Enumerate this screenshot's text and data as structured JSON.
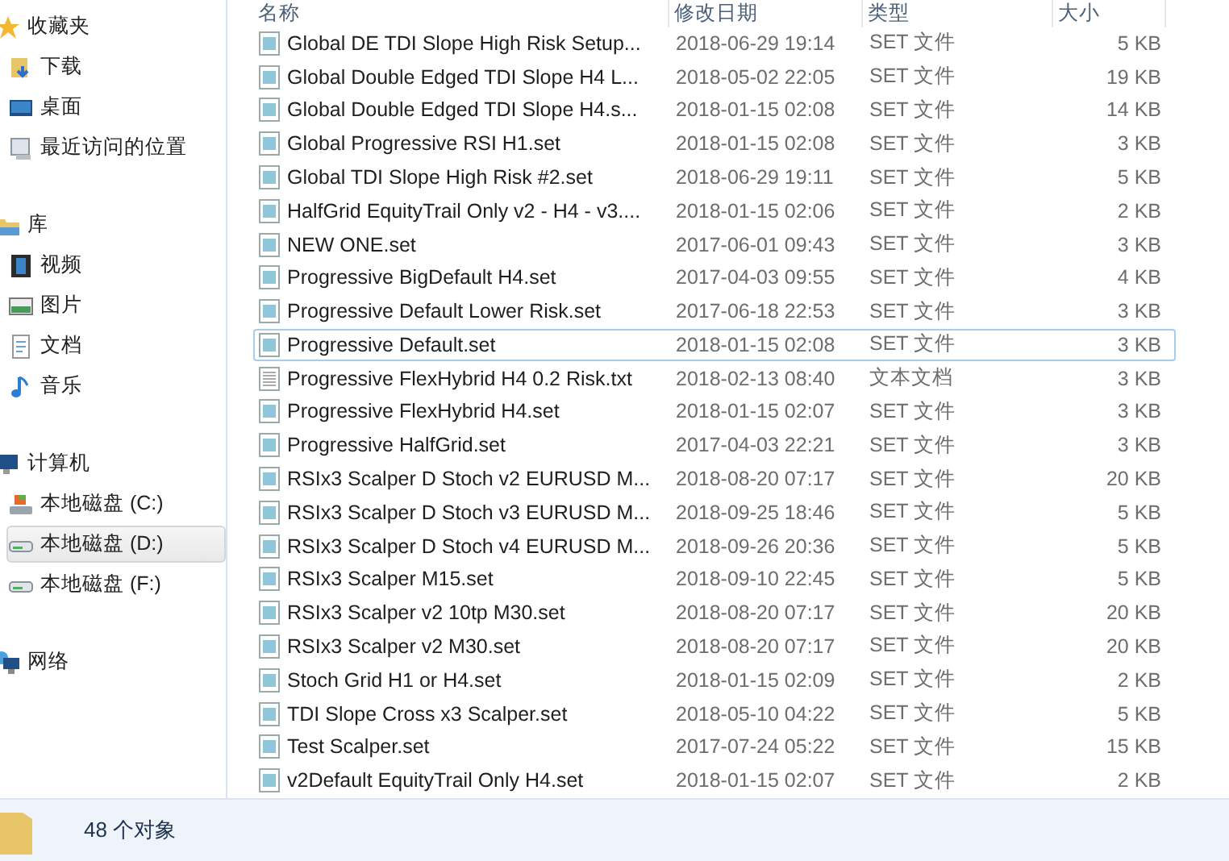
{
  "sidebar": {
    "groups": [
      {
        "label": "收藏夹",
        "kind": "star",
        "children": [
          {
            "label": "下载",
            "kind": "download",
            "selected": false
          },
          {
            "label": "桌面",
            "kind": "desktop",
            "selected": false
          },
          {
            "label": "最近访问的位置",
            "kind": "recent",
            "selected": false
          }
        ]
      },
      {
        "label": "库",
        "kind": "library",
        "children": [
          {
            "label": "视频",
            "kind": "video",
            "selected": false
          },
          {
            "label": "图片",
            "kind": "picture",
            "selected": false
          },
          {
            "label": "文档",
            "kind": "document",
            "selected": false
          },
          {
            "label": "音乐",
            "kind": "music",
            "selected": false
          }
        ]
      },
      {
        "label": "计算机",
        "kind": "computer",
        "children": [
          {
            "label": "本地磁盘 (C:)",
            "kind": "drive-system",
            "selected": false
          },
          {
            "label": "本地磁盘 (D:)",
            "kind": "drive",
            "selected": true
          },
          {
            "label": "本地磁盘 (F:)",
            "kind": "drive",
            "selected": false
          }
        ]
      },
      {
        "label": "网络",
        "kind": "network"
      }
    ]
  },
  "table": {
    "columns": [
      "名称",
      "修改日期",
      "类型",
      "大小"
    ],
    "rows": [
      {
        "name": "Global DE TDI Slope High Risk Setup...",
        "date": "2018-06-29 19:14",
        "type": "SET 文件",
        "size": "5 KB",
        "kind": "set",
        "selected": false
      },
      {
        "name": "Global Double Edged TDI Slope H4 L...",
        "date": "2018-05-02 22:05",
        "type": "SET 文件",
        "size": "19 KB",
        "kind": "set",
        "selected": false
      },
      {
        "name": "Global Double Edged TDI Slope H4.s...",
        "date": "2018-01-15 02:08",
        "type": "SET 文件",
        "size": "14 KB",
        "kind": "set",
        "selected": false
      },
      {
        "name": "Global Progressive RSI H1.set",
        "date": "2018-01-15 02:08",
        "type": "SET 文件",
        "size": "3 KB",
        "kind": "set",
        "selected": false
      },
      {
        "name": "Global TDI Slope High Risk #2.set",
        "date": "2018-06-29 19:11",
        "type": "SET 文件",
        "size": "5 KB",
        "kind": "set",
        "selected": false
      },
      {
        "name": "HalfGrid EquityTrail Only v2 - H4 - v3....",
        "date": "2018-01-15 02:06",
        "type": "SET 文件",
        "size": "2 KB",
        "kind": "set",
        "selected": false
      },
      {
        "name": "NEW ONE.set",
        "date": "2017-06-01 09:43",
        "type": "SET 文件",
        "size": "3 KB",
        "kind": "set",
        "selected": false
      },
      {
        "name": "Progressive BigDefault H4.set",
        "date": "2017-04-03 09:55",
        "type": "SET 文件",
        "size": "4 KB",
        "kind": "set",
        "selected": false
      },
      {
        "name": "Progressive Default Lower Risk.set",
        "date": "2017-06-18 22:53",
        "type": "SET 文件",
        "size": "3 KB",
        "kind": "set",
        "selected": false
      },
      {
        "name": "Progressive Default.set",
        "date": "2018-01-15 02:08",
        "type": "SET 文件",
        "size": "3 KB",
        "kind": "set",
        "selected": true
      },
      {
        "name": "Progressive FlexHybrid H4 0.2 Risk.txt",
        "date": "2018-02-13 08:40",
        "type": "文本文档",
        "size": "3 KB",
        "kind": "txt",
        "selected": false
      },
      {
        "name": "Progressive FlexHybrid H4.set",
        "date": "2018-01-15 02:07",
        "type": "SET 文件",
        "size": "3 KB",
        "kind": "set",
        "selected": false
      },
      {
        "name": "Progressive HalfGrid.set",
        "date": "2017-04-03 22:21",
        "type": "SET 文件",
        "size": "3 KB",
        "kind": "set",
        "selected": false
      },
      {
        "name": "RSIx3 Scalper D Stoch v2 EURUSD M...",
        "date": "2018-08-20 07:17",
        "type": "SET 文件",
        "size": "20 KB",
        "kind": "set",
        "selected": false
      },
      {
        "name": "RSIx3 Scalper D Stoch v3 EURUSD M...",
        "date": "2018-09-25 18:46",
        "type": "SET 文件",
        "size": "5 KB",
        "kind": "set",
        "selected": false
      },
      {
        "name": "RSIx3 Scalper D Stoch v4 EURUSD M...",
        "date": "2018-09-26 20:36",
        "type": "SET 文件",
        "size": "5 KB",
        "kind": "set",
        "selected": false
      },
      {
        "name": "RSIx3 Scalper M15.set",
        "date": "2018-09-10 22:45",
        "type": "SET 文件",
        "size": "5 KB",
        "kind": "set",
        "selected": false
      },
      {
        "name": "RSIx3 Scalper v2 10tp M30.set",
        "date": "2018-08-20 07:17",
        "type": "SET 文件",
        "size": "20 KB",
        "kind": "set",
        "selected": false
      },
      {
        "name": "RSIx3 Scalper v2 M30.set",
        "date": "2018-08-20 07:17",
        "type": "SET 文件",
        "size": "20 KB",
        "kind": "set",
        "selected": false
      },
      {
        "name": "Stoch Grid H1 or H4.set",
        "date": "2018-01-15 02:09",
        "type": "SET 文件",
        "size": "2 KB",
        "kind": "set",
        "selected": false
      },
      {
        "name": "TDI Slope Cross x3 Scalper.set",
        "date": "2018-05-10 04:22",
        "type": "SET 文件",
        "size": "5 KB",
        "kind": "set",
        "selected": false
      },
      {
        "name": "Test Scalper.set",
        "date": "2017-07-24 05:22",
        "type": "SET 文件",
        "size": "15 KB",
        "kind": "set",
        "selected": false
      },
      {
        "name": "v2Default EquityTrail Only H4.set",
        "date": "2018-01-15 02:07",
        "type": "SET 文件",
        "size": "2 KB",
        "kind": "set",
        "selected": false
      }
    ]
  },
  "status_bar": {
    "count": "48 个对象"
  }
}
